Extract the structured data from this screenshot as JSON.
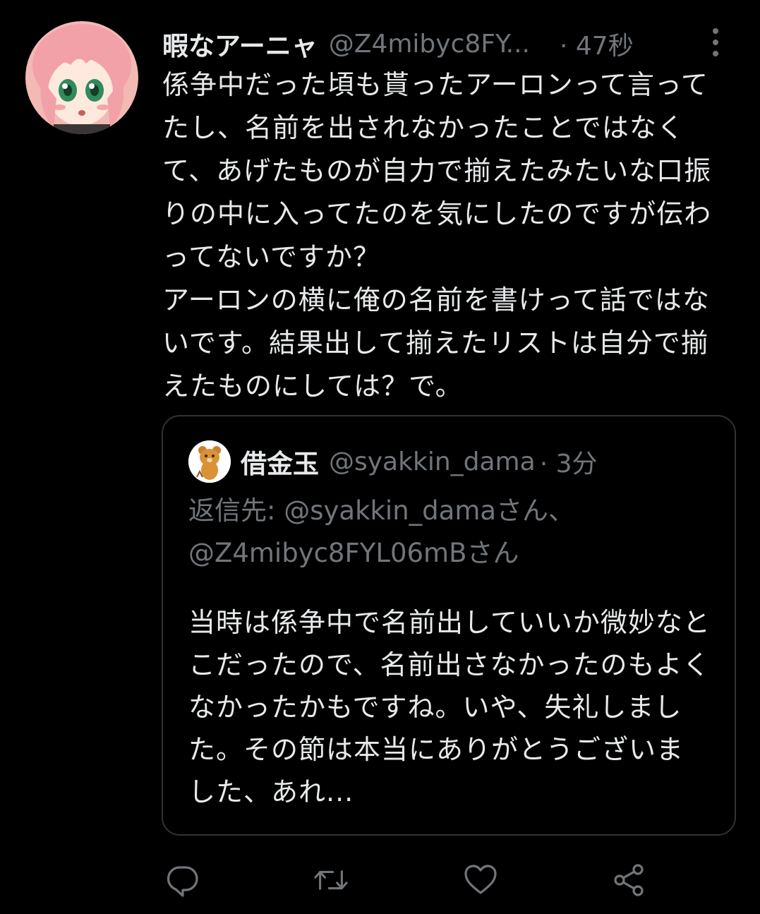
{
  "tweet": {
    "avatar_icon": "anime-girl-avatar-icon",
    "display_name": "暇なアーニャ",
    "handle": "@Z4mibyc8FY...",
    "time": "· 47秒",
    "more_icon": "more-vertical-icon",
    "text": "係争中だった頃も貰ったアーロンって言ってたし、名前を出されなかったことではなくて、あげたものが自力で揃えたみたいな口振りの中に入ってたのを気にしたのですが伝わってないですか？\nアーロンの横に俺の名前を書けって話ではないです。結果出して揃えたリストは自分で揃えたものにしては？で。"
  },
  "quote": {
    "avatar_icon": "bear-avatar-icon",
    "display_name": "借金玉",
    "handle": "@syakkin_dama",
    "time": "· 3分",
    "reply_to": "返信先: @syakkin_damaさん、\n@Z4mibyc8FYL06mBさん",
    "text": "当時は係争中で名前出していいか微妙なとこだったので、名前出さなかったのもよくなかったかもですね。いや、失礼しました。その節は本当にありがとうございました、あれ..."
  },
  "actions": {
    "reply_icon": "reply-icon",
    "retweet_icon": "retweet-icon",
    "like_icon": "heart-icon",
    "share_icon": "share-icon"
  },
  "colors": {
    "background": "#000000",
    "text_primary": "#e7e9ea",
    "text_secondary": "#71767b",
    "border": "#2f3336"
  }
}
